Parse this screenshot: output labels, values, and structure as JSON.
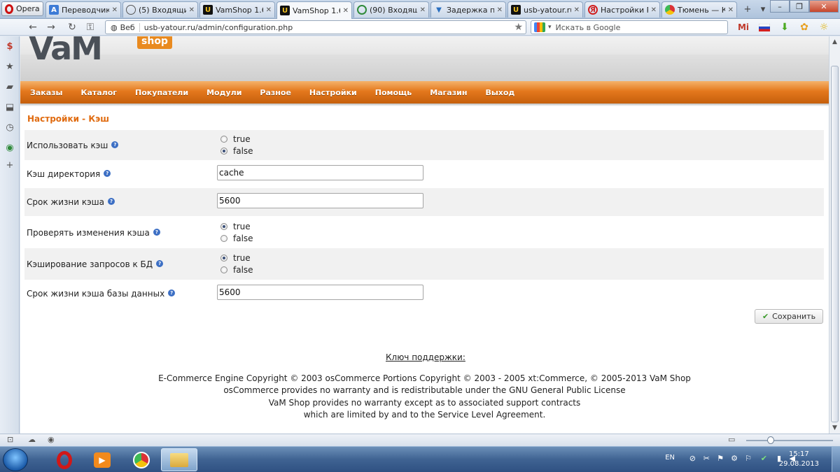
{
  "browser": {
    "menu_label": "Opera",
    "tabs": [
      {
        "label": "Переводчик ...",
        "icon": "translate-icon",
        "active": false
      },
      {
        "label": "(5) Входящие ...",
        "icon": "mail-icon",
        "active": false
      },
      {
        "label": "VamShop 1.68",
        "icon": "vamshop-icon",
        "active": false
      },
      {
        "label": "VamShop 1.68",
        "icon": "vamshop-icon",
        "active": true
      },
      {
        "label": "(90) Входящи...",
        "icon": "mail-icon",
        "active": false
      },
      {
        "label": "Задержка по...",
        "icon": "page-icon",
        "active": false
      },
      {
        "label": "usb-yatour.ru",
        "icon": "vamshop-icon",
        "active": false
      },
      {
        "label": "Настройки Р...",
        "icon": "yandex-icon",
        "active": false
      },
      {
        "label": "Тюмень — К...",
        "icon": "chrome-icon",
        "active": false
      }
    ],
    "address_badge": "Веб",
    "url": "usb-yatour.ru/admin/configuration.php",
    "search_placeholder": "Искать в Google"
  },
  "site": {
    "logo_text": "VaM",
    "logo_badge": "shop",
    "menu": [
      "Заказы",
      "Каталог",
      "Покупатели",
      "Модули",
      "Разное",
      "Настройки",
      "Помощь",
      "Магазин",
      "Выход"
    ],
    "page_title": "Настройки - Кэш",
    "settings": [
      {
        "label": "Использовать кэш",
        "type": "radio",
        "options": [
          "true",
          "false"
        ],
        "selected": "false"
      },
      {
        "label": "Кэш директория",
        "type": "text",
        "value": "cache"
      },
      {
        "label": "Срок жизни кэша",
        "type": "text",
        "value": "5600"
      },
      {
        "label": "Проверять изменения кэша",
        "type": "radio",
        "options": [
          "true",
          "false"
        ],
        "selected": "true"
      },
      {
        "label": "Кэширование запросов к БД",
        "type": "radio",
        "options": [
          "true",
          "false"
        ],
        "selected": "true"
      },
      {
        "label": "Срок жизни кэша базы данных",
        "type": "text",
        "value": "5600"
      }
    ],
    "save_label": "Сохранить",
    "support_key": "Ключ поддержки:",
    "footer": [
      "E-Commerce Engine Copyright © 2003 osCommerce Portions Copyright © 2003 - 2005 xt:Commerce, © 2005-2013 VaM Shop",
      "osCommerce provides no warranty and is redistributable under the GNU General Public License",
      "VaM Shop provides no warranty except as to associated support contracts",
      "which are limited by and to the Service Level Agreement."
    ]
  },
  "taskbar": {
    "language": "EN",
    "time": "15:17",
    "date": "29.08.2013"
  }
}
